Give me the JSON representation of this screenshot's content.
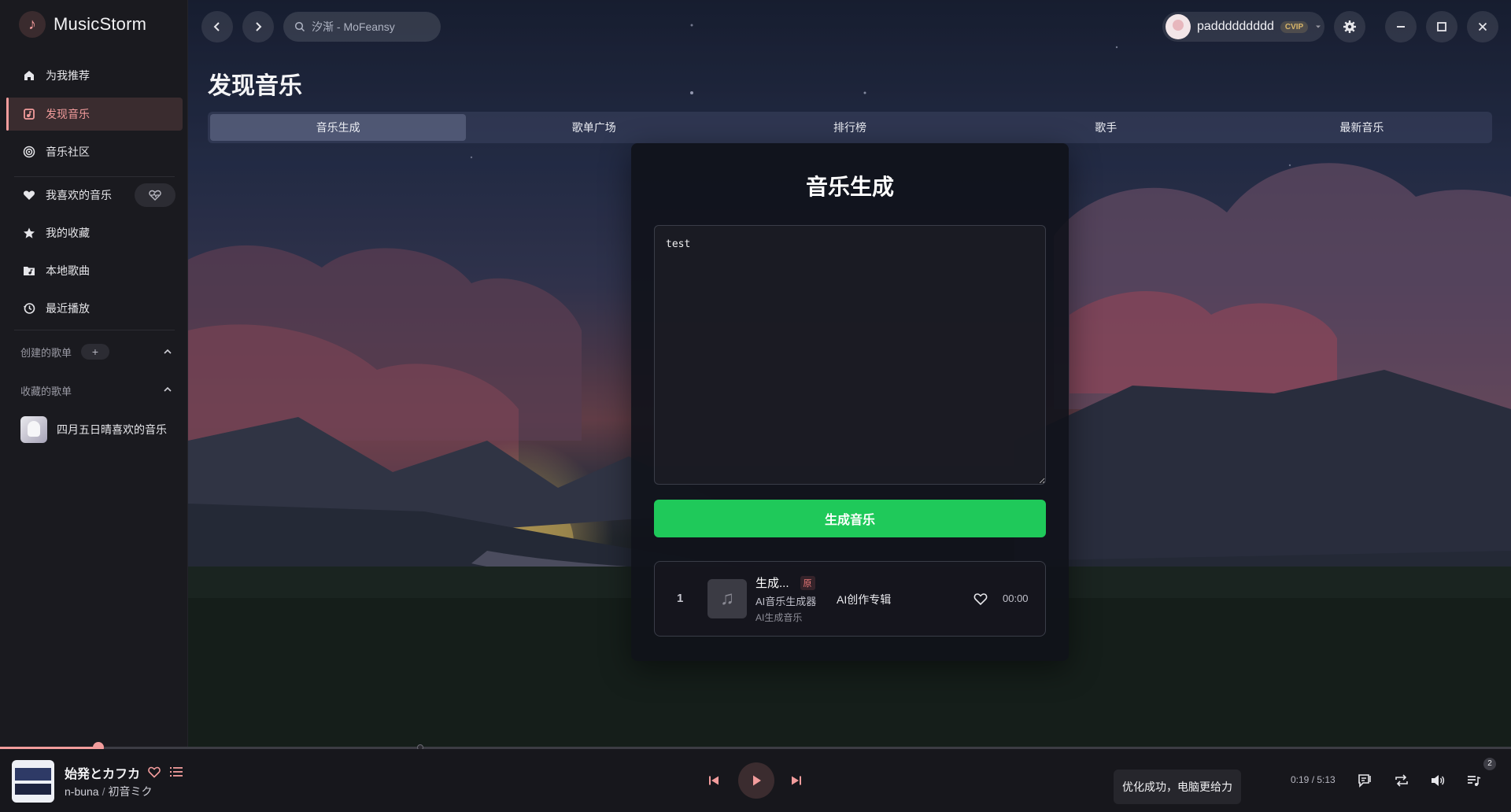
{
  "app": {
    "name": "MusicStorm"
  },
  "sidebar": {
    "nav": [
      {
        "label": "为我推荐",
        "icon": "home-icon"
      },
      {
        "label": "发现音乐",
        "icon": "discover-icon",
        "active": true
      },
      {
        "label": "音乐社区",
        "icon": "podcast-icon"
      },
      {
        "label": "我喜欢的音乐",
        "icon": "heart-icon"
      },
      {
        "label": "我的收藏",
        "icon": "star-icon"
      },
      {
        "label": "本地歌曲",
        "icon": "folder-music-icon"
      },
      {
        "label": "最近播放",
        "icon": "history-icon"
      }
    ],
    "created_section": "创建的歌单",
    "created_add": "+",
    "collected_section": "收藏的歌单",
    "collected_playlists": [
      {
        "name": "四月五日晴喜欢的音乐"
      }
    ]
  },
  "topbar": {
    "search_placeholder": "汐渐 - MoFeansy",
    "username": "paddddddddd",
    "vip_label": "CVIP"
  },
  "page": {
    "title": "发现音乐",
    "tabs": [
      {
        "label": "音乐生成",
        "active": true
      },
      {
        "label": "歌单广场"
      },
      {
        "label": "排行榜"
      },
      {
        "label": "歌手"
      },
      {
        "label": "最新音乐"
      }
    ]
  },
  "generator": {
    "title": "音乐生成",
    "prompt_value": "test",
    "generate_label": "生成音乐",
    "results": [
      {
        "index": "1",
        "name": "生成...",
        "badge": "原",
        "artist": "AI音乐生成器",
        "subtitle": "AI生成音乐",
        "album": "AI创作专辑",
        "duration": "00:00"
      }
    ]
  },
  "player": {
    "title": "始発とカフカ",
    "artist": "n-buna",
    "artist_sep": "/",
    "feat": "初音ミク",
    "time": "0:19 / 5:13",
    "progress": 0.065,
    "toast": "优化成功，电脑更给力",
    "queue_count": "2",
    "accent": "#f29c9c"
  }
}
